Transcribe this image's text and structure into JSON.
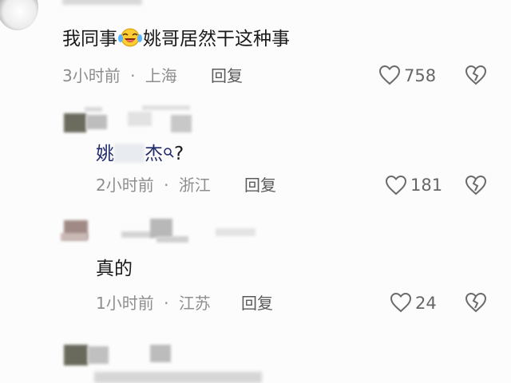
{
  "comments": [
    {
      "text_before": "我同事",
      "text_after": "姚哥居然干这种事",
      "time": "3小时前",
      "location": "上海",
      "reply_label": "回复",
      "likes": "758"
    },
    {
      "text_a": "姚",
      "text_b": "杰",
      "text_c": "?",
      "time": "2小时前",
      "location": "浙江",
      "reply_label": "回复",
      "likes": "181"
    },
    {
      "text": "真的",
      "time": "1小时前",
      "location": "江苏",
      "reply_label": "回复",
      "likes": "24"
    }
  ],
  "meta_separator": "·",
  "colors": {
    "background": "#fcfcfc",
    "text": "#1a1a1a",
    "meta": "#8e8e8e",
    "icon": "#6a6a6a"
  },
  "icons": [
    "laughing-crying-emoji",
    "heart-icon",
    "broken-heart-icon",
    "search-icon"
  ]
}
